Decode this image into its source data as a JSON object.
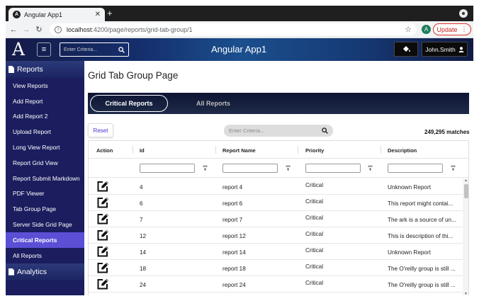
{
  "browser": {
    "tab_title": "Angular App1",
    "tab_favicon": "A",
    "url_host": "localhost",
    "url_path": ":4200/page/reports/grid-tab-group/1",
    "profile_initial": "A",
    "update_label": "Update"
  },
  "header": {
    "logo": "A",
    "search_placeholder": "Enter Criteria...",
    "title": "Angular App1",
    "user": "John.Smith"
  },
  "sidebar": {
    "sections": [
      {
        "label": "Reports",
        "items": [
          {
            "label": "View Reports"
          },
          {
            "label": "Add Report"
          },
          {
            "label": "Add Report 2"
          },
          {
            "label": "Upload Report"
          },
          {
            "label": "Long View Report"
          },
          {
            "label": "Report Grid View"
          },
          {
            "label": "Report Submit Markdown"
          },
          {
            "label": "PDF Viewer"
          },
          {
            "label": "Tab Group Page"
          },
          {
            "label": "Server Side Grid Page"
          },
          {
            "label": "Critical Reports",
            "active": true
          },
          {
            "label": "All Reports"
          }
        ]
      },
      {
        "label": "Analytics",
        "items": []
      }
    ]
  },
  "main": {
    "page_title": "Grid Tab Group Page",
    "tabs": [
      {
        "label": "Critical Reports",
        "active": true
      },
      {
        "label": "All Reports",
        "active": false
      }
    ],
    "reset_label": "Reset",
    "search_placeholder": "Enter Criteria...",
    "match_count": "249,295 matches",
    "columns": [
      "Action",
      "Id",
      "Report Name",
      "Priority",
      "Description"
    ],
    "rows": [
      {
        "id": "4",
        "name": "report 4",
        "priority": "Critical",
        "description": "Unknown Report"
      },
      {
        "id": "6",
        "name": "report 6",
        "priority": "Critical",
        "description": "This report might contai..."
      },
      {
        "id": "7",
        "name": "report 7",
        "priority": "Critical",
        "description": "The ark is a source of un..."
      },
      {
        "id": "12",
        "name": "report 12",
        "priority": "Critical",
        "description": "This is description of thi..."
      },
      {
        "id": "14",
        "name": "report 14",
        "priority": "Critical",
        "description": "Unknown Report"
      },
      {
        "id": "18",
        "name": "report 18",
        "priority": "Critical",
        "description": "The O'reilly group is still ..."
      },
      {
        "id": "24",
        "name": "report 24",
        "priority": "Critical",
        "description": "The O'reilly group is still ..."
      }
    ]
  },
  "colors": {
    "accent": "#5b4fd6",
    "sidebar_bg": "#1b1d5e",
    "update": "#d93025"
  }
}
